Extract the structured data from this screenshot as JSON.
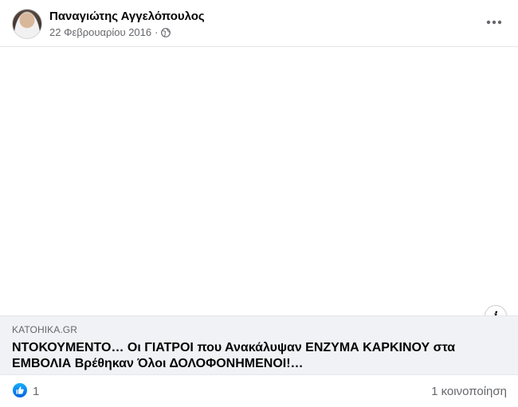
{
  "post": {
    "author": "Παναγιώτης Αγγελόπουλος",
    "date": "22 Φεβρουαρίου 2016",
    "separator": "·",
    "privacy_icon": "globe-icon",
    "more_icon": "more-options-icon"
  },
  "link_preview": {
    "domain": "KATOHIKA.GR",
    "title": "ΝΤΟΚΟΥΜΕΝΤΟ… Οι ΓΙΑΤΡΟΙ που Ανακάλυψαν ΕΝΖΥΜΑ ΚΑΡΚΙΝΟΥ στα ΕΜΒΟΛΙΑ Βρέθηκαν Όλοι ΔΟΛΟΦΟΝΗΜΕΝΟΙ!…",
    "info_label": "i"
  },
  "reactions": {
    "like_count": "1",
    "shares": "1 κοινοποίηση",
    "like_icon": "thumbs-up-icon",
    "accent": "#1877f2"
  }
}
